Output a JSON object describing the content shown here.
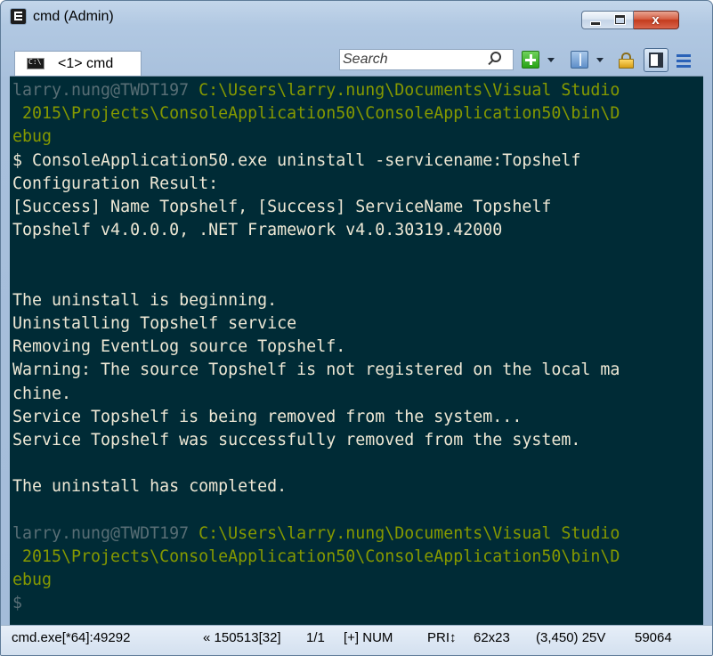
{
  "window": {
    "title": "cmd (Admin)",
    "close_glyph": "x"
  },
  "tabs": [
    {
      "label": "<1> cmd"
    }
  ],
  "search": {
    "placeholder": "Search"
  },
  "console": {
    "lines": [
      [
        {
          "text": "larry.nung@TWDT197 ",
          "style": "user"
        },
        {
          "text": "C:\\Users\\larry.nung\\Documents\\Visual Studio",
          "style": "path"
        }
      ],
      [
        {
          "text": " 2015\\Projects\\ConsoleApplication50\\ConsoleApplication50\\bin\\D",
          "style": "path"
        }
      ],
      [
        {
          "text": "ebug",
          "style": "path"
        }
      ],
      [
        {
          "text": "$ ConsoleApplication50.exe uninstall -servicename:Topshelf",
          "style": "out"
        }
      ],
      [
        {
          "text": "Configuration Result:",
          "style": "out"
        }
      ],
      [
        {
          "text": "[Success] Name Topshelf, [Success] ServiceName Topshelf",
          "style": "out"
        }
      ],
      [
        {
          "text": "Topshelf v4.0.0.0, .NET Framework v4.0.30319.42000",
          "style": "out"
        }
      ],
      [],
      [],
      [
        {
          "text": "The uninstall is beginning.",
          "style": "out"
        }
      ],
      [
        {
          "text": "Uninstalling Topshelf service",
          "style": "out"
        }
      ],
      [
        {
          "text": "Removing EventLog source Topshelf.",
          "style": "out"
        }
      ],
      [
        {
          "text": "Warning: The source Topshelf is not registered on the local ma",
          "style": "out"
        }
      ],
      [
        {
          "text": "chine.",
          "style": "out"
        }
      ],
      [
        {
          "text": "Service Topshelf is being removed from the system...",
          "style": "out"
        }
      ],
      [
        {
          "text": "Service Topshelf was successfully removed from the system.",
          "style": "out"
        }
      ],
      [],
      [
        {
          "text": "The uninstall has completed.",
          "style": "out"
        }
      ],
      [],
      [
        {
          "text": "larry.nung@TWDT197 ",
          "style": "user"
        },
        {
          "text": "C:\\Users\\larry.nung\\Documents\\Visual Studio",
          "style": "path"
        }
      ],
      [
        {
          "text": " 2015\\Projects\\ConsoleApplication50\\ConsoleApplication50\\bin\\D",
          "style": "path"
        }
      ],
      [
        {
          "text": "ebug",
          "style": "path"
        }
      ],
      [
        {
          "text": "$",
          "style": "user"
        }
      ]
    ]
  },
  "statusbar": {
    "process": "cmd.exe[*64]:49292",
    "position": "« 150513[32]",
    "pages": "1/1",
    "flags": "[+] NUM",
    "priority": "PRI↕",
    "size": "62x23",
    "cursor": "(3,450) 25V",
    "pid": "59064"
  },
  "colors": {
    "console_bg": "#002b36",
    "prompt_user": "#586e75",
    "prompt_path": "#859900",
    "output_text": "#eee8d5"
  },
  "icons": {
    "app": "console-app-icon",
    "tab": "console-tab-icon",
    "search": "search-icon",
    "new_console": "plus-icon",
    "panes": "panes-icon",
    "lock": "lock-icon",
    "view": "view-icon",
    "menu": "hamburger-menu-icon"
  }
}
